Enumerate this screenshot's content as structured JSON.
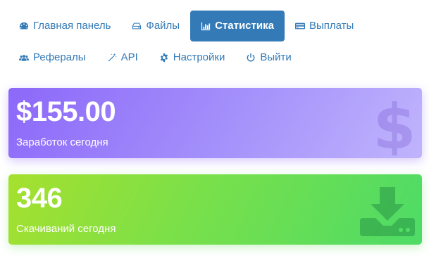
{
  "nav": {
    "items": [
      {
        "label": "Главная панель",
        "icon": "dashboard-icon"
      },
      {
        "label": "Файлы",
        "icon": "hdd-icon"
      },
      {
        "label": "Статистика",
        "icon": "bar-chart-icon",
        "active": true
      },
      {
        "label": "Выплаты",
        "icon": "credit-card-icon"
      },
      {
        "label": "Рефералы",
        "icon": "users-icon"
      },
      {
        "label": "API",
        "icon": "magic-wand-icon"
      },
      {
        "label": "Настройки",
        "icon": "gear-icon"
      },
      {
        "label": "Выйти",
        "icon": "power-icon"
      }
    ]
  },
  "cards": {
    "earnings": {
      "value": "$155.00",
      "label": "Заработок сегодня",
      "icon": "dollar-icon"
    },
    "downloads": {
      "value": "346",
      "label": "Скачиваний сегодня",
      "icon": "download-icon"
    }
  },
  "colors": {
    "link": "#337ab7",
    "active_bg": "#337ab7",
    "earnings_gradient": [
      "#8c68f9",
      "#c0b4fc"
    ],
    "downloads_gradient": [
      "#a6e02e",
      "#4ddb67"
    ]
  }
}
